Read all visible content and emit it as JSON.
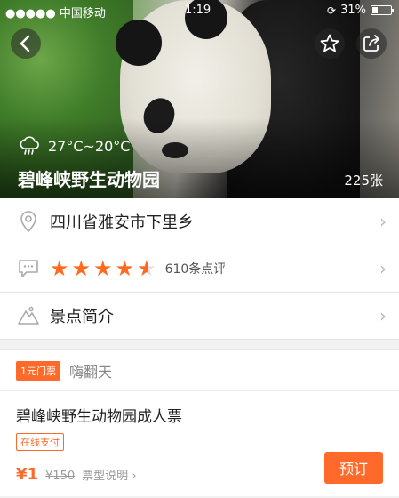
{
  "status_bar": {
    "carrier": "●●●●● 中国移动",
    "time": "1:19",
    "battery": "31%",
    "battery_level": 0.31
  },
  "hero": {
    "weather_icon": "cloud-rain-icon",
    "temperature": "27°C~20°C",
    "title": "碧峰峡野生动物园",
    "photo_count": "225张"
  },
  "info": {
    "address": "四川省雅安市下里乡",
    "rating": 4.5,
    "review_count": "610条点评",
    "intro_label": "景点简介"
  },
  "promo": {
    "tag": "1元门票",
    "text": "嗨翻天"
  },
  "ticket": {
    "name": "碧峰峡野生动物园成人票",
    "pay_tag": "在线支付",
    "price": "¥1",
    "original_price": "¥150",
    "desc_link": "票型说明",
    "book_label": "预订"
  },
  "colors": {
    "accent": "#ff6a2a",
    "star": "#ff6a1f"
  }
}
